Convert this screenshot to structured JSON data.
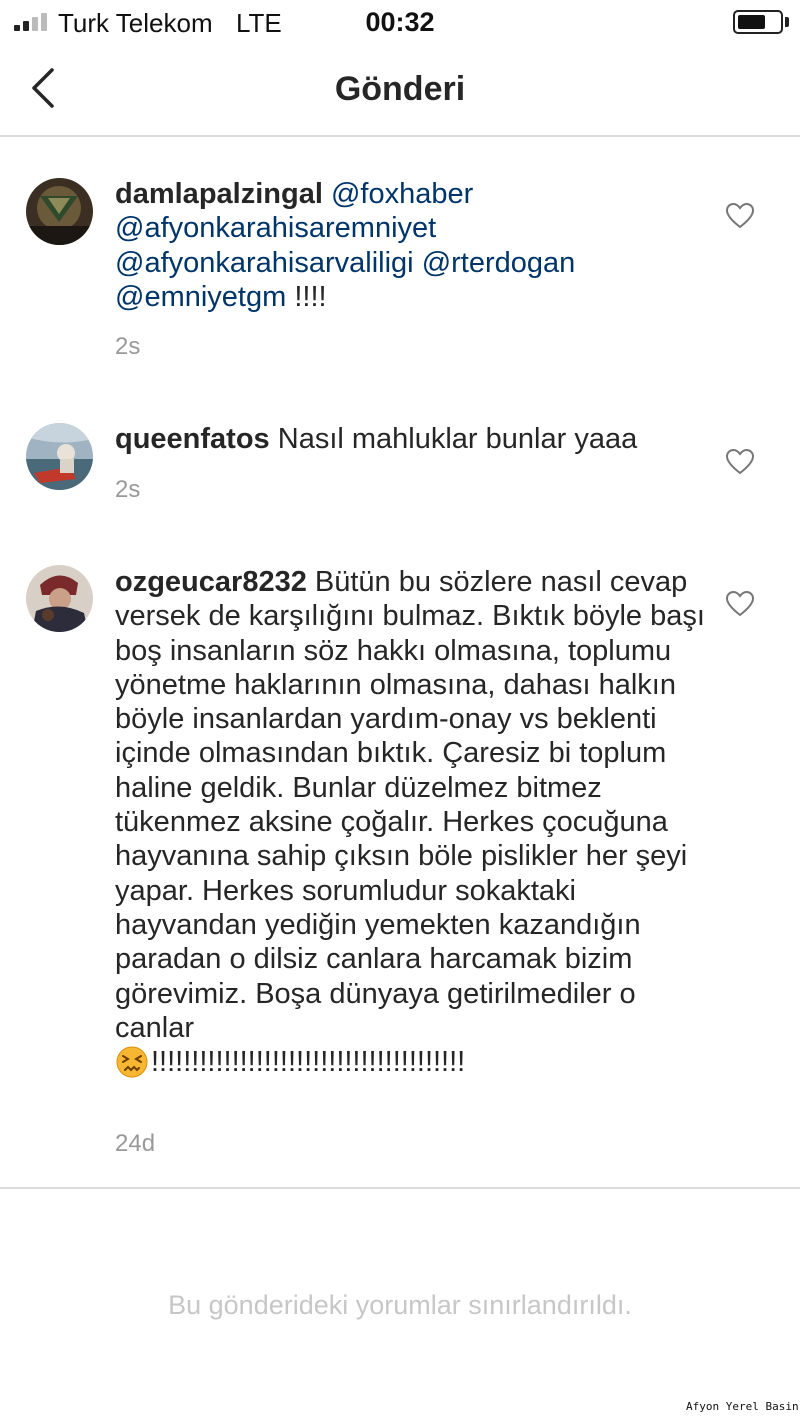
{
  "status_bar": {
    "carrier": "Turk Telekom",
    "network": "LTE",
    "time": "00:32"
  },
  "nav": {
    "title": "Gönderi",
    "back_icon": "chevron-left-icon"
  },
  "comments": [
    {
      "username": "damlapalzingal",
      "text_parts": [
        {
          "text": "@foxhaber",
          "mention": true
        },
        {
          "text": " ",
          "mention": false
        },
        {
          "text": "@afyonkarahisaremniyet",
          "mention": true
        },
        {
          "text": " ",
          "mention": false
        },
        {
          "text": "@afyonkarahisarvaliligi",
          "mention": true
        },
        {
          "text": " ",
          "mention": false
        },
        {
          "text": "@rterdogan",
          "mention": true
        },
        {
          "text": " ",
          "mention": false
        },
        {
          "text": "@emniyetgm",
          "mention": true
        },
        {
          "text": " !!!!",
          "mention": false
        }
      ],
      "time": "2s",
      "avatar_icon": "user-avatar-icon"
    },
    {
      "username": "queenfatos",
      "text": "Nasıl mahluklar bunlar yaaa",
      "time": "2s",
      "avatar_icon": "user-avatar-icon"
    },
    {
      "username": "ozgeucar8232",
      "text": "Bütün bu sözlere nasıl cevap versek de karşılığını bulmaz. Bıktık böyle başı boş insanların söz hakkı olmasına, toplumu yönetme haklarının olmasına, dahası halkın böyle insanlardan yardım-onay vs beklenti içinde olmasından bıktık. Çaresiz  bi toplum haline geldik. Bunlar düzelmez bitmez tükenmez aksine çoğalır. Herkes çocuğuna hayvanına sahip çıksın böle pislikler her şeyi yapar. Herkes sorumludur sokaktaki hayvandan yediğin yemekten kazandığın paradan o dilsiz canlara harcamak bizim görevimiz. Boşa dünyaya getirilmediler o canlar",
      "emoji": "persevering-face-emoji",
      "exclamations": "!!!!!!!!!!!!!!!!!!!!!!!!!!!!!!!!!!!!!!!",
      "time": "24d",
      "avatar_icon": "user-avatar-icon"
    }
  ],
  "footer": {
    "restricted_text": "Bu gönderideki yorumlar sınırlandırıldı."
  },
  "watermark": "Afyon Yerel Basin",
  "colors": {
    "text": "#262626",
    "mention": "#003569",
    "muted": "#999999",
    "divider": "#dbdbdb",
    "restricted": "#c7c7c7"
  }
}
